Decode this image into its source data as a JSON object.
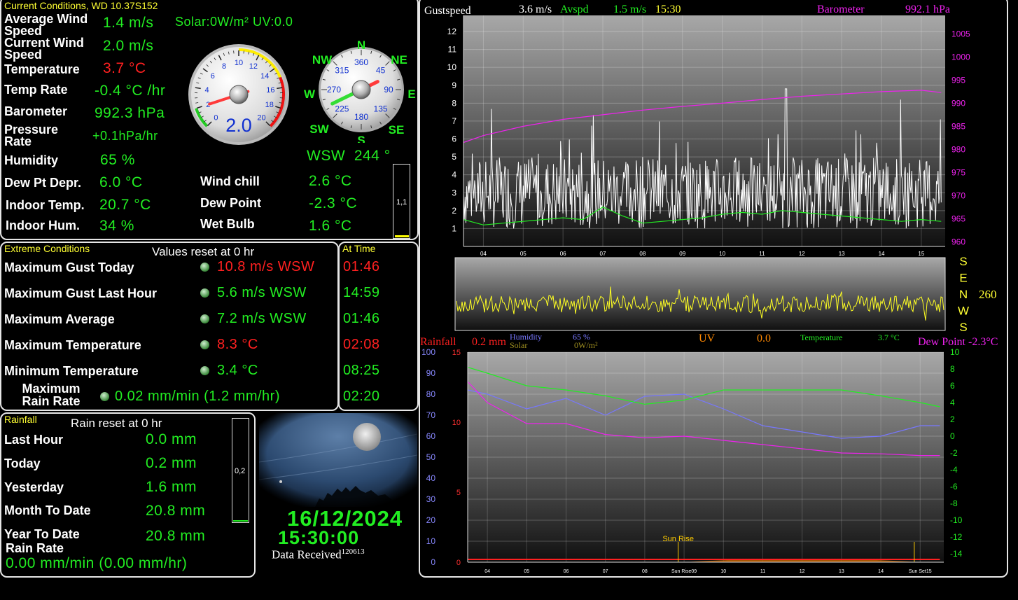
{
  "current": {
    "title": "Current Conditions, WD 10.37S152",
    "avg_wind_label": "Average Wind Speed",
    "avg_wind": "1.4 m/s",
    "solar_uv": "Solar:0W/m² UV:0.0",
    "cur_wind_label": "Current Wind Speed",
    "cur_wind": "2.0 m/s",
    "temp_label": "Temperature",
    "temp": "3.7 °C",
    "temp_rate_label": "Temp Rate",
    "temp_rate": "-0.4 °C /hr",
    "baro_label": "Barometer",
    "baro": "992.3 hPa",
    "press_rate_label": "Pressure Rate",
    "press_rate": "+0.1hPa/hr",
    "hum_label": "Humidity",
    "hum": "65 %",
    "dew_depr_label": "Dew Pt Depr.",
    "dew_depr": "6.0 °C",
    "indoor_temp_label": "Indoor Temp.",
    "indoor_temp": "20.7 °C",
    "indoor_hum_label": "Indoor Hum.",
    "indoor_hum": "34 %",
    "wind_chill_label": "Wind chill",
    "wind_chill": "2.6 °C",
    "dew_point_label": "Dew Point",
    "dew_point": "-2.3 °C",
    "wet_bulb_label": "Wet Bulb",
    "wet_bulb": "1.6 °C",
    "wind_dir": "WSW  244 °",
    "uv_bar_label": "1,1"
  },
  "gauge": {
    "value_text": "2.0",
    "value": 2.0,
    "ticks": [
      "0",
      "2",
      "4",
      "6",
      "8",
      "10",
      "12",
      "14",
      "16",
      "18",
      "20"
    ]
  },
  "compass": {
    "points": [
      "N",
      "NE",
      "E",
      "SE",
      "S",
      "SW",
      "W",
      "NW"
    ],
    "degrees": [
      "360",
      "45",
      "90",
      "135",
      "180",
      "225",
      "270",
      "315"
    ],
    "direction_deg": 244
  },
  "extreme": {
    "title": "Extreme Conditions",
    "reset_note": "Values reset at 0 hr",
    "at_time_title": "At Time",
    "rows": [
      {
        "label": "Maximum Gust Today",
        "value": "10.8 m/s WSW",
        "time": "01:46",
        "alert": true
      },
      {
        "label": "Maximum Gust Last Hour",
        "value": "5.6 m/s WSW",
        "time": "14:59",
        "alert": false
      },
      {
        "label": "Maximum Average",
        "value": "7.2 m/s WSW",
        "time": "01:46",
        "alert": false
      },
      {
        "label": "Maximum Temperature",
        "value": "8.3 °C",
        "time": "02:08",
        "alert": true
      },
      {
        "label": "Minimum Temperature",
        "value": "3.4 °C",
        "time": "08:25",
        "alert": false
      },
      {
        "label": "Maximum Rain Rate",
        "value": "0.02 mm/min (1.2 mm/hr)",
        "time": "02:20",
        "alert": false
      }
    ]
  },
  "rainfall": {
    "title": "Rainfall",
    "reset_note": "Rain reset at 0 hr",
    "last_hour_label": "Last Hour",
    "last_hour": "0.0 mm",
    "today_label": "Today",
    "today": "0.2 mm",
    "yesterday_label": "Yesterday",
    "yesterday": "1.6 mm",
    "month_label": "Month To Date",
    "month": "20.8 mm",
    "year_label": "Year To Date",
    "year": "20.8 mm",
    "rate_label": "Rain Rate",
    "rate": "0.00 mm/min (0.00 mm/hr)",
    "bar_label": "0,2"
  },
  "camera": {
    "date": "16/12/2024",
    "time": "15:30:00",
    "received_label": "Data Received",
    "received_code": "120613"
  },
  "colors": {
    "green": "#22ee22",
    "red": "#ff2020",
    "yellow": "#ffff33",
    "magenta": "#ee22ee",
    "white": "#ffffff",
    "blue": "#7777ff",
    "orange": "#ff8800"
  },
  "chart_data": [
    {
      "type": "line",
      "header": {
        "gust_label": "Gustspeed",
        "gust": "3.6 m/s",
        "avg_label": "Avspd",
        "avg": "1.5 m/s",
        "time": "15:30",
        "baro_label": "Barometer",
        "baro": "992.1 hPa"
      },
      "x_ticks": [
        "04",
        "05",
        "06",
        "07",
        "08",
        "09",
        "10",
        "11",
        "12",
        "13",
        "14",
        "15"
      ],
      "y_left_ticks": [
        "1",
        "2",
        "3",
        "4",
        "5",
        "6",
        "7",
        "8",
        "9",
        "10",
        "11",
        "12"
      ],
      "y_right_ticks": [
        "960",
        "965",
        "970",
        "975",
        "980",
        "985",
        "990",
        "995",
        "1000",
        "1005"
      ],
      "ylim_left": [
        0,
        12.9
      ],
      "ylim_right": [
        959,
        1009
      ],
      "series": [
        {
          "name": "Gustspeed",
          "color": "#ffffff",
          "axis": "left",
          "summary": "gusts 1-9 m/s, peak 8.8 near 11.6"
        },
        {
          "name": "Avspd",
          "color": "#22ee22",
          "axis": "left",
          "x": [
            3.5,
            4,
            4.5,
            5,
            5.5,
            6,
            6.5,
            7,
            7.5,
            8,
            8.5,
            9,
            9.5,
            10,
            10.5,
            11,
            11.5,
            12,
            12.5,
            13,
            13.5,
            14,
            14.5,
            15,
            15.5
          ],
          "values": [
            1.5,
            1.2,
            1.3,
            1.4,
            1.5,
            1.6,
            1.5,
            2.2,
            1.7,
            1.3,
            1.4,
            1.5,
            1.6,
            1.8,
            1.9,
            1.8,
            2.0,
            1.9,
            1.8,
            1.7,
            1.6,
            1.5,
            1.4,
            1.5,
            1.4
          ]
        },
        {
          "name": "Barometer",
          "color": "#ee22ee",
          "axis": "right",
          "x": [
            3.5,
            4,
            5,
            6,
            7,
            8,
            9,
            10,
            11,
            12,
            13,
            14,
            15,
            15.5
          ],
          "values": [
            981.5,
            983,
            985,
            986.5,
            987.5,
            988.5,
            989.3,
            990,
            990.8,
            991.5,
            992,
            992.5,
            992.8,
            992.3
          ]
        }
      ]
    },
    {
      "type": "line",
      "name": "Wind Direction",
      "y_ticks": [
        "S",
        "E",
        "N",
        "W",
        "S"
      ],
      "current_value": "260",
      "series": [
        {
          "name": "Direction",
          "color": "#ffff22",
          "summary": "oscillating around W (~260)"
        }
      ]
    },
    {
      "type": "line",
      "header": {
        "rain_label": "Rainfall",
        "rain": "0.2 mm",
        "hum_label": "Humidity",
        "hum": "65 %",
        "solar_label": "Solar",
        "solar": "0W/m²",
        "uv_label": "UV",
        "uv": "0.0",
        "temp_label": "Temperature",
        "temp": "3.7 °C",
        "dew_label": "Dew Point",
        "dew": "-2.3°C"
      },
      "x_ticks": [
        "04",
        "05",
        "06",
        "07",
        "08",
        "09",
        "10",
        "11",
        "12",
        "13",
        "14",
        "15"
      ],
      "y_hum_ticks": [
        "0",
        "10",
        "20",
        "30",
        "40",
        "50",
        "60",
        "70",
        "80",
        "90",
        "100"
      ],
      "y_rain_ticks": [
        "0",
        "5",
        "10",
        "15"
      ],
      "y_temp_ticks": [
        "-14",
        "-12",
        "-10",
        "-8",
        "-6",
        "-4",
        "-2",
        "0",
        "2",
        "4",
        "6",
        "8",
        "10"
      ],
      "sun_rise_label": "Sun Rise",
      "sun_rise_axis": "Sun Rise09",
      "sun_set_axis": "Sun Set15",
      "series": [
        {
          "name": "Temperature",
          "color": "#22ee22",
          "axis": "temp",
          "x": [
            3.5,
            4,
            5,
            6,
            7,
            8,
            9,
            10,
            11,
            12,
            13,
            14,
            15,
            15.5
          ],
          "values": [
            8.2,
            7.5,
            6.0,
            5.5,
            4.8,
            3.8,
            4.3,
            5.5,
            5.5,
            5.5,
            5.5,
            4.8,
            4.0,
            3.5
          ]
        },
        {
          "name": "Humidity",
          "color": "#7777ff",
          "axis": "hum",
          "x": [
            3.5,
            4,
            5,
            6,
            7,
            8,
            9,
            10,
            11,
            12,
            13,
            14,
            15,
            15.5
          ],
          "values": [
            82,
            80,
            73,
            78,
            70,
            79,
            80,
            73,
            65,
            62,
            59,
            60,
            65,
            65
          ]
        },
        {
          "name": "Dew Point",
          "color": "#ee22ee",
          "axis": "temp",
          "x": [
            3.5,
            4,
            5,
            6,
            7,
            8,
            9,
            10,
            11,
            12,
            13,
            14,
            15,
            15.5
          ],
          "values": [
            6.5,
            4.0,
            1.5,
            1.5,
            0.2,
            -0.2,
            0.0,
            -0.5,
            -1.0,
            -1.5,
            -2.0,
            -2.1,
            -2.3,
            -2.3
          ]
        },
        {
          "name": "Rainfall",
          "color": "#ff2020",
          "axis": "rain",
          "x": [
            3.5,
            15.5
          ],
          "values": [
            0.2,
            0.2
          ]
        }
      ]
    }
  ]
}
